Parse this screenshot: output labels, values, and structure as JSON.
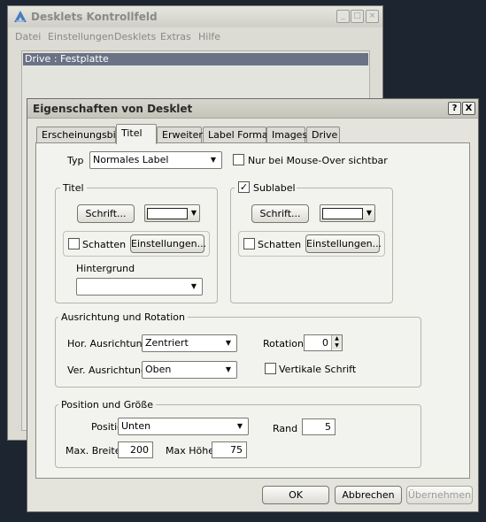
{
  "bg_window": {
    "title": "Desklets Kontrollfeld",
    "menu": [
      "Datei",
      "Einstellungen",
      "Desklets",
      "Extras",
      "Hilfe"
    ],
    "list_item": "Drive : Festplatte"
  },
  "dialog": {
    "title": "Eigenschaften von Desklet",
    "help_glyph": "?",
    "close_glyph": "X",
    "tabs": [
      "Erscheinungsbild",
      "Titel",
      "Erweitert",
      "Label Format",
      "Images",
      "Drive"
    ],
    "active_tab": "Titel",
    "typ": {
      "label": "Typ",
      "value": "Normales Label",
      "mouseover_label": "Nur bei Mouse-Over sichtbar",
      "mouseover_checked": false
    },
    "titel_group": {
      "title": "Titel",
      "font_button": "Schrift...",
      "color": "#ffffff",
      "shadow_label": "Schatten",
      "shadow_checked": false,
      "settings_button": "Einstellungen...",
      "background_label": "Hintergrund",
      "background_value": ""
    },
    "sublabel_group": {
      "title": "Sublabel",
      "checked": true,
      "font_button": "Schrift...",
      "color": "#ffffff",
      "shadow_label": "Schatten",
      "shadow_checked": false,
      "settings_button": "Einstellungen..."
    },
    "alignment": {
      "title": "Ausrichtung und Rotation",
      "hor_label": "Hor. Ausrichtung",
      "hor_value": "Zentriert",
      "ver_label": "Ver. Ausrichtung",
      "ver_value": "Oben",
      "rotation_label": "Rotation",
      "rotation_value": "0",
      "vertical_text_label": "Vertikale Schrift",
      "vertical_text_checked": false
    },
    "position": {
      "title": "Position und Größe",
      "position_label": "Position",
      "position_value": "Unten",
      "margin_label": "Rand",
      "margin_value": "5",
      "max_width_label": "Max. Breite",
      "max_width_value": "200",
      "max_height_label": "Max Höhe",
      "max_height_value": "75"
    },
    "buttons": {
      "ok": "OK",
      "cancel": "Abbrechen",
      "apply": "Übernehmen"
    }
  }
}
